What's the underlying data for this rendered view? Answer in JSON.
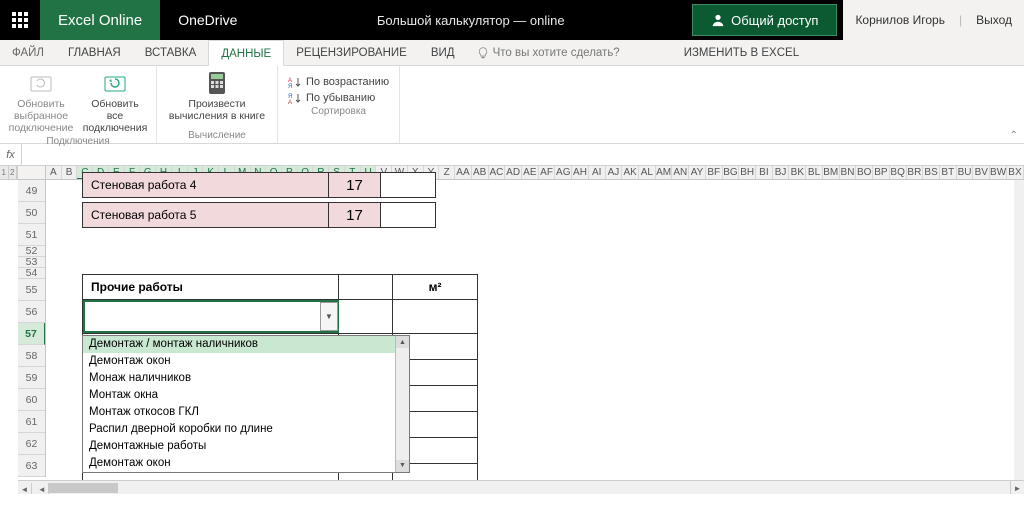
{
  "titlebar": {
    "brand": "Excel Online",
    "onedrive": "OneDrive",
    "doc_title": "Большой калькулятор — online",
    "share": "Общий доступ",
    "user": "Корнилов Игорь",
    "exit": "Выход"
  },
  "tabs": {
    "file": "ФАЙЛ",
    "home": "ГЛАВНАЯ",
    "insert": "ВСТАВКА",
    "data": "ДАННЫЕ",
    "review": "РЕЦЕНЗИРОВАНИЕ",
    "view": "ВИД",
    "tell_me": "Что вы хотите сделать?",
    "edit_excel": "ИЗМЕНИТЬ В EXCEL"
  },
  "ribbon": {
    "refresh_selected": "Обновить выбранное подключение",
    "refresh_all": "Обновить все подключения",
    "connections_label": "Подключения",
    "calc": "Произвести вычисления в книге",
    "calc_label": "Вычисление",
    "sort_asc": "По возрастанию",
    "sort_desc": "По убыванию",
    "sort_label": "Сортировка"
  },
  "fx": {
    "label": "fx"
  },
  "columns_selected": [
    "C",
    "D",
    "E",
    "F",
    "G",
    "H",
    "I",
    "J",
    "K",
    "L",
    "M",
    "N",
    "O",
    "P",
    "Q",
    "R",
    "S",
    "T",
    "U"
  ],
  "columns_rest": [
    "A",
    "B",
    "V",
    "W",
    "X",
    "Y",
    "Z",
    "AA",
    "AB",
    "AC",
    "AD",
    "AE",
    "AF",
    "AG",
    "AH",
    "AI",
    "AJ",
    "AK",
    "AL",
    "AM",
    "AN",
    "AY",
    "BF",
    "BG",
    "BH",
    "BI",
    "BJ",
    "BK",
    "BL",
    "BM",
    "BN",
    "BO",
    "BP",
    "BQ",
    "BR",
    "BS",
    "BT",
    "BU",
    "BV",
    "BW",
    "BX"
  ],
  "rows": [
    "49",
    "50",
    "51",
    "52",
    "53",
    "54",
    "55",
    "56",
    "57",
    "58",
    "59",
    "60",
    "61",
    "62",
    "63"
  ],
  "active_row": "57",
  "pink_rows": [
    {
      "label": "Стеновая работа 4",
      "val": "17"
    },
    {
      "label": "Стеновая работа 5",
      "val": "17"
    }
  ],
  "table2": {
    "header": {
      "c1": "Прочие работы",
      "c3": "м²"
    }
  },
  "dropdown": {
    "options": [
      "Демонтаж / монтаж наличников",
      "Демонтаж окон",
      "Монаж наличников",
      "Монтаж окна",
      "Монтаж откосов ГКЛ",
      "Распил дверной коробки по  длине",
      "Демонтажные работы",
      "Демонтаж  окон"
    ]
  }
}
